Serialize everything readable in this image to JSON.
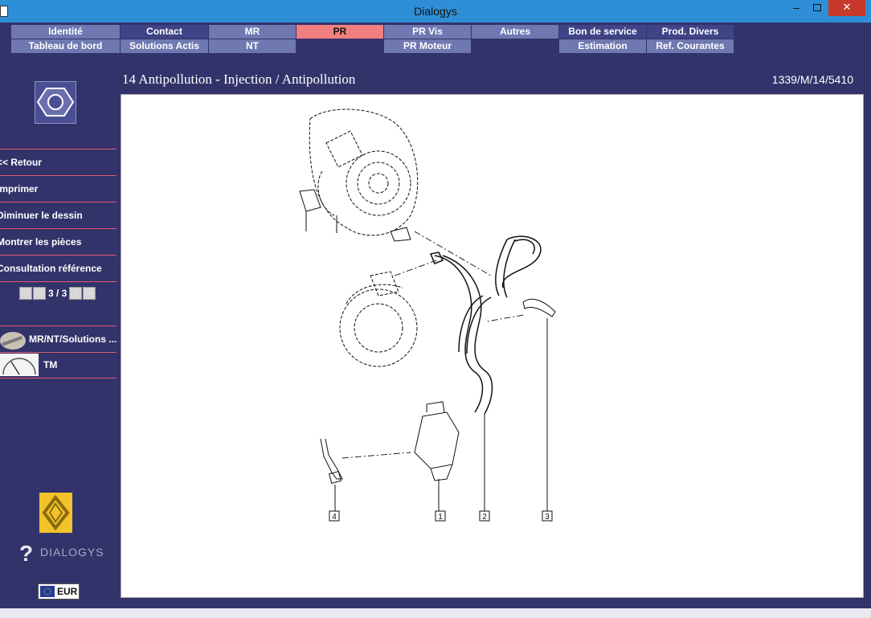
{
  "window": {
    "title": "Dialogys",
    "min": "–",
    "close": "✕"
  },
  "tabs_row1": [
    {
      "label": "Identité"
    },
    {
      "label": "Contact"
    },
    {
      "label": "MR"
    },
    {
      "label": "PR"
    },
    {
      "label": "PR Vis"
    },
    {
      "label": "Autres"
    },
    {
      "label": "Bon de service"
    },
    {
      "label": "Prod. Divers"
    }
  ],
  "tabs_row2": [
    {
      "label": "Tableau de bord"
    },
    {
      "label": "Solutions Actis"
    },
    {
      "label": "NT"
    },
    {
      "label": ""
    },
    {
      "label": "PR Moteur"
    },
    {
      "label": ""
    },
    {
      "label": "Estimation"
    },
    {
      "label": "Ref. Courantes"
    }
  ],
  "content": {
    "title": "14 Antipollution - Injection / Antipollution",
    "reference": "1339/M/14/5410"
  },
  "sidebar": {
    "items": [
      {
        "label": "<< Retour"
      },
      {
        "label": "Imprimer"
      },
      {
        "label": "Diminuer le dessin"
      },
      {
        "label": "Montrer les pièces"
      },
      {
        "label": "Consultation référence"
      }
    ],
    "pager": {
      "first": "<<",
      "prev": "<<",
      "text": "3 / 3",
      "next": ">",
      "last": ">>"
    },
    "links": [
      {
        "label": "MR/NT/Solutions ..."
      },
      {
        "label": "TM"
      }
    ],
    "brand": "DIALOGYS",
    "brand_mark": "?",
    "currency": "EUR"
  },
  "drawing": {
    "callouts": [
      "4",
      "1",
      "2",
      "3"
    ]
  }
}
